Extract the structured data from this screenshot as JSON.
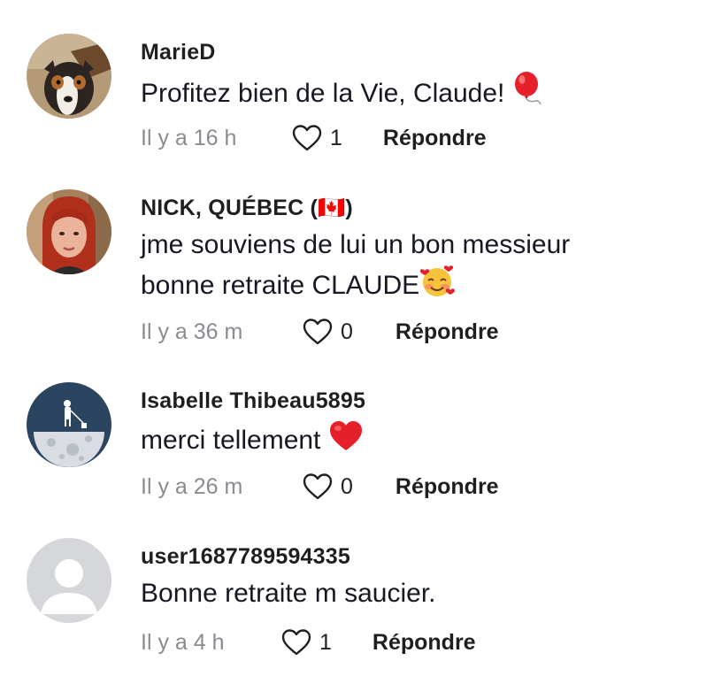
{
  "comments": [
    {
      "username": "MarieD",
      "text": "Profitez bien de la Vie, Claude!",
      "emoji": "balloon-emoji",
      "time": "Il y a 16 h",
      "likes": "1",
      "reply_label": "Répondre"
    },
    {
      "username": "NICK, QUÉBEC (🇨🇦)",
      "text_line1": "jme souviens de lui un bon messieur",
      "text_line2": "bonne retraite CLAUDE",
      "emoji": "smiling-face-with-hearts-emoji",
      "time": "Il y a 36 m",
      "likes": "0",
      "reply_label": "Répondre"
    },
    {
      "username": "Isabelle Thibeau5895",
      "text": "merci tellement",
      "emoji": "red-heart-emoji",
      "time": "Il y a 26 m",
      "likes": "0",
      "reply_label": "Répondre"
    },
    {
      "username": "user1687789594335",
      "text": "Bonne retraite m saucier.",
      "time": "Il y a 4 h",
      "likes": "1",
      "reply_label": "Répondre"
    }
  ],
  "colors": {
    "text": "#161823",
    "muted": "#8a8b91",
    "heart_red": "#e5202b",
    "canada_red": "#d52b1e"
  }
}
